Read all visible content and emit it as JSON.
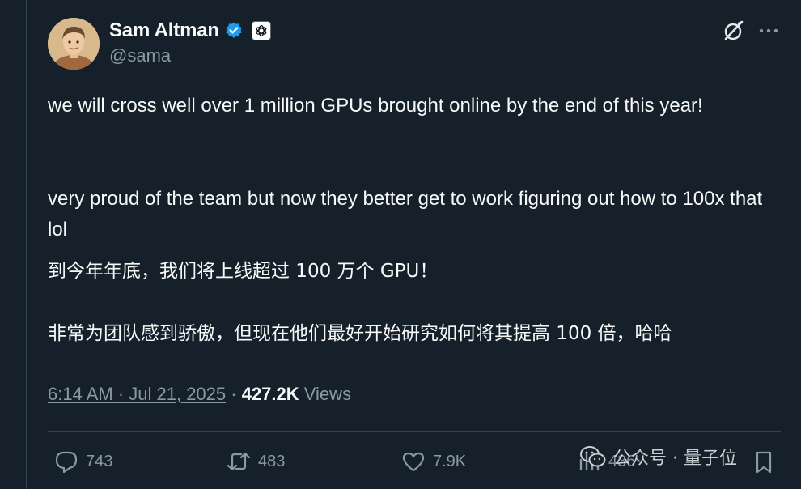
{
  "author": {
    "display_name": "Sam Altman",
    "handle": "@sama"
  },
  "tweet": {
    "paragraph_1": "we will cross well over 1 million GPUs brought online by the end of this year!",
    "paragraph_2": "very proud of the team but now they better get to work figuring out how to 100x that lol",
    "translation_1": "到今年年底，我们将上线超过 100 万个 GPU！",
    "translation_2": "非常为团队感到骄傲，但现在他们最好开始研究如何将其提高 100 倍，哈哈"
  },
  "meta": {
    "timestamp": "6:14 AM · Jul 21, 2025",
    "separator": " · ",
    "views_count": "427.2K",
    "views_label": "Views"
  },
  "actions": {
    "replies": "743",
    "reposts": "483",
    "likes": "7.9K",
    "analytics": "436"
  },
  "watermark": {
    "text": "公众号 · 量子位"
  },
  "colors": {
    "background": "#15202b",
    "text_primary": "#f7f9f9",
    "text_secondary": "#8b98a5",
    "verified_blue": "#1d9bf0",
    "divider": "#38444d"
  },
  "icons": {
    "verified": "verified-badge-icon",
    "affiliation": "openai-logo-icon",
    "grok": "grok-icon",
    "more": "more-icon",
    "reply": "reply-icon",
    "repost": "repost-icon",
    "like": "heart-icon",
    "analytics": "analytics-icon",
    "bookmark": "bookmark-icon"
  }
}
